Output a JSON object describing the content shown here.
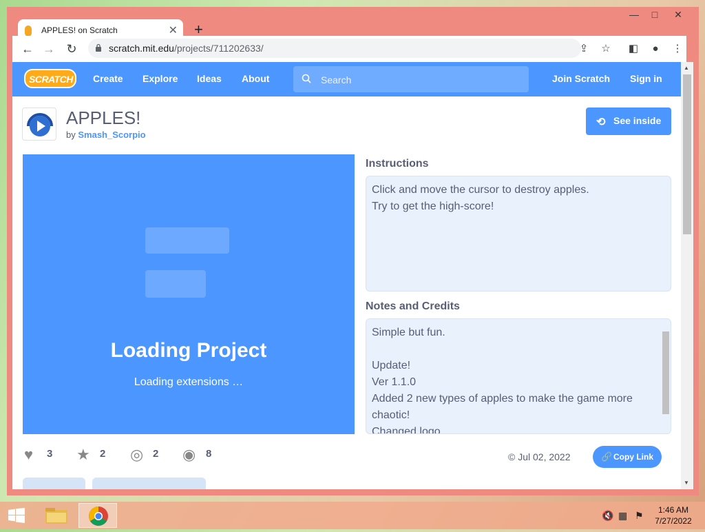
{
  "browser": {
    "tab_title": "APPLES! on Scratch",
    "tab_close": "✕",
    "new_tab": "+",
    "window_controls": {
      "minimize": "—",
      "maximize": "□",
      "close": "✕"
    },
    "nav": {
      "back": "←",
      "forward": "→",
      "reload": "↻"
    },
    "url_host": "scratch.mit.edu",
    "url_path": "/projects/711202633/"
  },
  "scratch_nav": {
    "logo": "SCRATCH",
    "create": "Create",
    "explore": "Explore",
    "ideas": "Ideas",
    "about": "About",
    "search_placeholder": "Search",
    "join": "Join Scratch",
    "signin": "Sign in"
  },
  "project": {
    "title": "APPLES!",
    "by": "by",
    "author": "Smash_Scorpio",
    "see_inside": "See inside",
    "loading_title": "Loading Project",
    "loading_sub": "Loading extensions …"
  },
  "instructions": {
    "heading": "Instructions",
    "lines": [
      "Click and move the cursor to destroy apples.",
      "Try to get the high-score!"
    ]
  },
  "notes": {
    "heading": "Notes and Credits",
    "lines": [
      "Simple but fun.",
      "",
      "Update!",
      "Ver 1.1.0",
      "Added 2 new types of apples to make the game more chaotic!",
      "Changed logo"
    ]
  },
  "stats": {
    "loves": "3",
    "favorites": "2",
    "remixes": "2",
    "views": "8"
  },
  "shared_date": "© Jul 02, 2022",
  "copy_link": "Copy Link",
  "taskbar": {
    "time": "1:46 AM",
    "date": "7/27/2022"
  },
  "colors": {
    "scratch_blue": "#4c97ff",
    "logo_orange": "#ffab19",
    "window_frame": "#ef8a80"
  }
}
